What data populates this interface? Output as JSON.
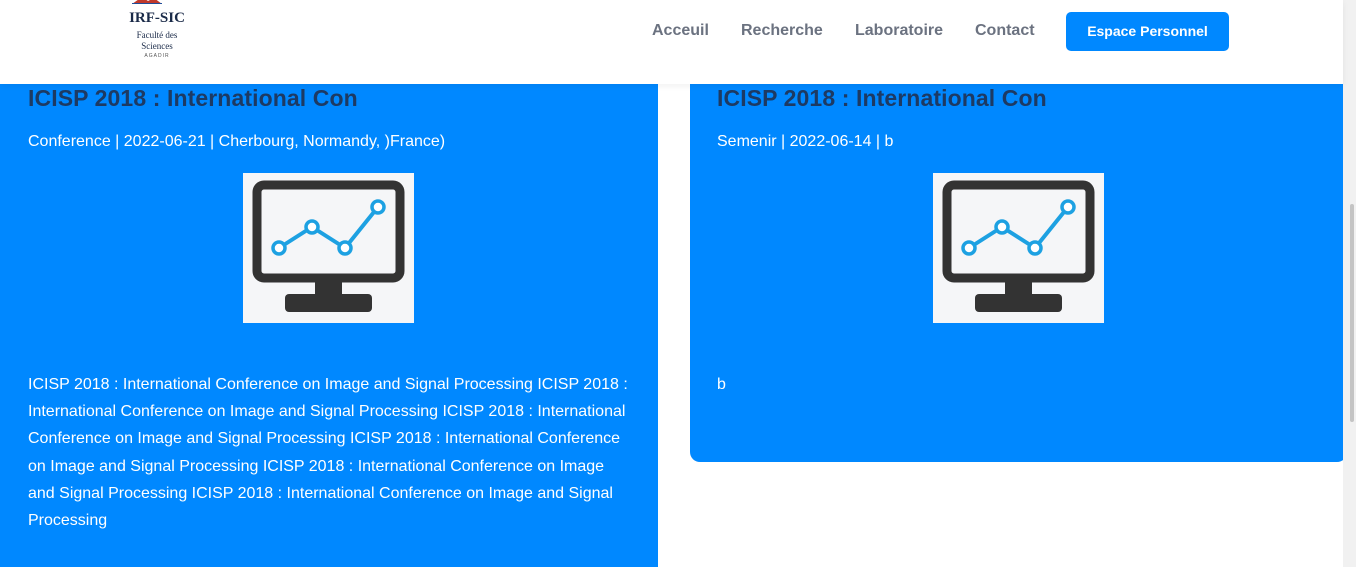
{
  "header": {
    "logo": {
      "title": "IRF-SIC",
      "subtitle_line1": "Faculté des",
      "subtitle_line2": "Sciences",
      "small": "AGADIR"
    },
    "nav": [
      "Acceuil",
      "Recherche",
      "Laboratoire",
      "Contact"
    ],
    "cta_label": "Espace Personnel"
  },
  "cards": [
    {
      "title": "ICISP 2018 : International Con",
      "meta": "Conference | 2022-06-21 | Cherbourg, Normandy, )France)",
      "thumbnail_icon": "monitor-chart-icon",
      "description": "ICISP 2018 : International Conference on Image and Signal Processing ICISP 2018 : International Conference on Image and Signal Processing ICISP 2018 : International Conference on Image and Signal Processing ICISP 2018 : International Conference on Image and Signal Processing ICISP 2018 : International Conference on Image and Signal Processing ICISP 2018 : International Conference on Image and Signal Processing"
    },
    {
      "title": "ICISP 2018 : International Con",
      "meta": "Semenir | 2022-06-14 | b",
      "thumbnail_icon": "monitor-chart-icon",
      "description": "b"
    }
  ],
  "colors": {
    "accent": "#0088ff",
    "title": "#1d3a63",
    "nav_text": "#6b7280"
  }
}
